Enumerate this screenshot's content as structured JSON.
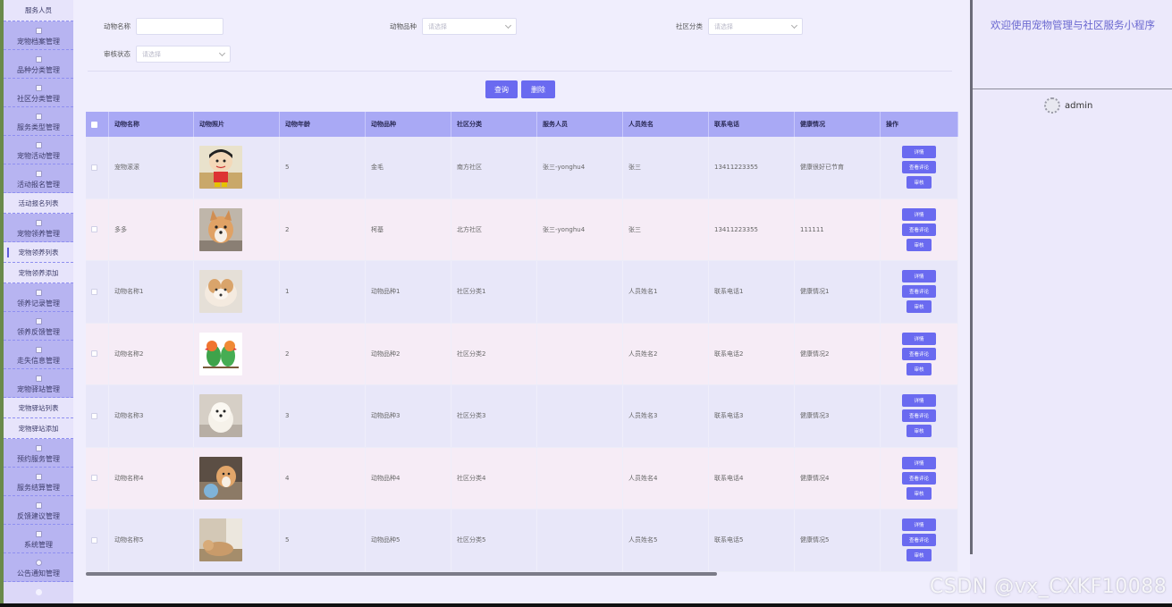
{
  "sidebar": {
    "top_item": "服务人员",
    "items": [
      {
        "label": "宠物档案管理",
        "type": "group"
      },
      {
        "label": "品种分类管理",
        "type": "group"
      },
      {
        "label": "社区分类管理",
        "type": "group"
      },
      {
        "label": "服务类型管理",
        "type": "group"
      },
      {
        "label": "宠物活动管理",
        "type": "group"
      },
      {
        "label": "活动报名管理",
        "type": "group"
      },
      {
        "label": "活动报名列表",
        "type": "sub"
      },
      {
        "label": "宠物领养管理",
        "type": "group"
      },
      {
        "label": "宠物领养列表",
        "type": "sub",
        "active": true
      },
      {
        "label": "宠物领养添加",
        "type": "sub"
      },
      {
        "label": "领养记录管理",
        "type": "group"
      },
      {
        "label": "领养反馈管理",
        "type": "group"
      },
      {
        "label": "走失信息管理",
        "type": "group"
      },
      {
        "label": "宠物驿站管理",
        "type": "group"
      },
      {
        "label": "宠物驿站列表",
        "type": "sub"
      },
      {
        "label": "宠物驿站添加",
        "type": "sub"
      },
      {
        "label": "预约服务管理",
        "type": "group"
      },
      {
        "label": "服务结算管理",
        "type": "group"
      },
      {
        "label": "反馈建议管理",
        "type": "group"
      },
      {
        "label": "系统管理",
        "type": "group"
      },
      {
        "label": "公告通知管理",
        "type": "group",
        "icon": "info-icon"
      }
    ]
  },
  "filters": {
    "animal_name_label": "动物名称",
    "animal_name_value": "",
    "breed_label": "动物品种",
    "breed_placeholder": "请选择",
    "community_label": "社区分类",
    "community_placeholder": "请选择",
    "review_label": "审核状态",
    "review_placeholder": "请选择"
  },
  "actions": {
    "query": "查询",
    "delete": "删除"
  },
  "table": {
    "headers": [
      "动物名称",
      "动物照片",
      "动物年龄",
      "动物品种",
      "社区分类",
      "服务人员",
      "人员姓名",
      "联系电话",
      "健康情况",
      "操作"
    ],
    "op_labels": [
      "详情",
      "查看评论",
      "审核"
    ],
    "rows": [
      {
        "name": "宠物滚滚",
        "photo": "cartoon",
        "age": "5",
        "breed": "金毛",
        "community": "南方社区",
        "staff": "张三-yonghu4",
        "staff_name": "张三",
        "phone": "13411223355",
        "health": "健康很好已节育"
      },
      {
        "name": "多多",
        "photo": "corgi",
        "age": "2",
        "breed": "柯基",
        "community": "北方社区",
        "staff": "张三-yonghu4",
        "staff_name": "张三",
        "phone": "13411223355",
        "health": "111111"
      },
      {
        "name": "动物名称1",
        "photo": "fluffy-dog",
        "age": "1",
        "breed": "动物品种1",
        "community": "社区分类1",
        "staff": "",
        "staff_name": "人员姓名1",
        "phone": "联系电话1",
        "health": "健康情况1"
      },
      {
        "name": "动物名称2",
        "photo": "parrots",
        "age": "2",
        "breed": "动物品种2",
        "community": "社区分类2",
        "staff": "",
        "staff_name": "人员姓名2",
        "phone": "联系电话2",
        "health": "健康情况2"
      },
      {
        "name": "动物名称3",
        "photo": "white-dog",
        "age": "3",
        "breed": "动物品种3",
        "community": "社区分类3",
        "staff": "",
        "staff_name": "人员姓名3",
        "phone": "联系电话3",
        "health": "健康情况3"
      },
      {
        "name": "动物名称4",
        "photo": "corgi-toy",
        "age": "4",
        "breed": "动物品种4",
        "community": "社区分类4",
        "staff": "",
        "staff_name": "人员姓名4",
        "phone": "联系电话4",
        "health": "健康情况4"
      },
      {
        "name": "动物名称5",
        "photo": "lying-dog",
        "age": "5",
        "breed": "动物品种5",
        "community": "社区分类5",
        "staff": "",
        "staff_name": "人员姓名5",
        "phone": "联系电话5",
        "health": "健康情况5"
      }
    ]
  },
  "right_panel": {
    "welcome": "欢迎使用宠物管理与社区服务小程序",
    "username": "admin"
  },
  "watermark": "CSDN @vx_CXKF10088",
  "colors": {
    "accent": "#6a6af0",
    "header": "#a9a9f5",
    "sidebar_group": "#b7b4f1",
    "welcome_text": "#6a68d0"
  }
}
